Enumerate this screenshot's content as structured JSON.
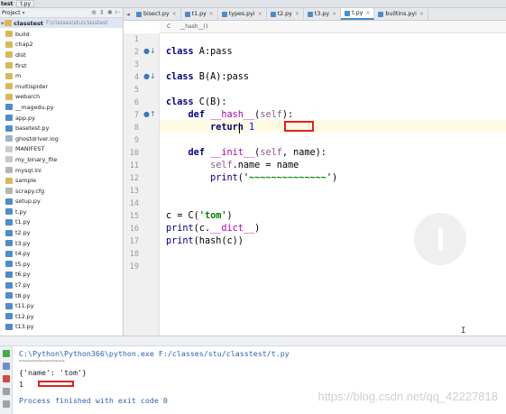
{
  "titlebar": {
    "project_name": "test",
    "file_crumb": "t.py"
  },
  "project_panel": {
    "header_label": "Project",
    "tools": [
      "⊕",
      "⇕",
      "✱",
      "⊢"
    ],
    "root": {
      "name": "classtest",
      "path": "F:\\classes\\stu\\classtest"
    },
    "items": [
      {
        "label": "build",
        "type": "folder"
      },
      {
        "label": "chap2",
        "type": "folder"
      },
      {
        "label": "dist",
        "type": "folder"
      },
      {
        "label": "first",
        "type": "folder"
      },
      {
        "label": "m",
        "type": "folder"
      },
      {
        "label": "multispider",
        "type": "folder"
      },
      {
        "label": "webarch",
        "type": "folder"
      },
      {
        "label": "__magedu.py",
        "type": "py"
      },
      {
        "label": "app.py",
        "type": "py"
      },
      {
        "label": "basetest.py",
        "type": "py"
      },
      {
        "label": "ghostdriver.log",
        "type": "log"
      },
      {
        "label": "MANIFEST",
        "type": "txt"
      },
      {
        "label": "my_binary_file",
        "type": "file"
      },
      {
        "label": "mysql.ini",
        "type": "cfg"
      },
      {
        "label": "sample",
        "type": "sample"
      },
      {
        "label": "scrapy.cfg",
        "type": "cfg"
      },
      {
        "label": "setup.py",
        "type": "py"
      },
      {
        "label": "t.py",
        "type": "py"
      },
      {
        "label": "t1.py",
        "type": "py"
      },
      {
        "label": "t2.py",
        "type": "py"
      },
      {
        "label": "t3.py",
        "type": "py"
      },
      {
        "label": "t4.py",
        "type": "py"
      },
      {
        "label": "t5.py",
        "type": "py"
      },
      {
        "label": "t6.py",
        "type": "py"
      },
      {
        "label": "t7.py",
        "type": "py"
      },
      {
        "label": "t8.py",
        "type": "py"
      },
      {
        "label": "t11.py",
        "type": "py"
      },
      {
        "label": "t12.py",
        "type": "py"
      },
      {
        "label": "t13.py",
        "type": "py"
      }
    ]
  },
  "tabs": [
    {
      "label": "bisect.py",
      "active": false
    },
    {
      "label": "t1.py",
      "active": false
    },
    {
      "label": "types.pyi",
      "active": false
    },
    {
      "label": "t2.py",
      "active": false
    },
    {
      "label": "t3.py",
      "active": false
    },
    {
      "label": "t.py",
      "active": true
    },
    {
      "label": "builtins.pyi",
      "active": false
    }
  ],
  "tab_close_glyph": "×",
  "editor": {
    "breadcrumb": [
      "C",
      "__hash__()"
    ],
    "line_numbers": [
      "1",
      "2",
      "3",
      "4",
      "5",
      "6",
      "7",
      "8",
      "9",
      "10",
      "11",
      "12",
      "13",
      "14",
      "15",
      "16",
      "17",
      "18",
      "19"
    ],
    "gutter_marks": {
      "2": "●↓",
      "4": "●↓",
      "7": "●↑"
    },
    "code": {
      "l2": {
        "kw": "class",
        "rest": " A:pass"
      },
      "l4": {
        "kw": "class",
        "rest": " B(A):pass"
      },
      "l6": {
        "kw": "class",
        "rest": " C(B):"
      },
      "l7": {
        "indent": "    ",
        "kw": "def",
        "sp": " ",
        "name": "__hash__",
        "open": "(",
        "self": "self",
        "close": "):"
      },
      "l8": {
        "indent": "        ",
        "kw": "return",
        "sp": " ",
        "num": "1"
      },
      "l10": {
        "indent": "    ",
        "kw": "def",
        "sp": " ",
        "name": "__init__",
        "open": "(",
        "self": "self",
        "rest": ", name):"
      },
      "l11": {
        "indent": "        ",
        "self": "self",
        "rest": ".name = name"
      },
      "l12": {
        "indent": "        ",
        "fn": "print",
        "open": "(",
        "str": "'~~~~~~~~~~~~~~'",
        "close": ")"
      },
      "l15": {
        "pre": "c = C(",
        "str": "'tom'",
        "close": ")"
      },
      "l16": {
        "fn": "print",
        "pre": "(c.",
        "attr": "__dict__",
        "close": ")"
      },
      "l17": {
        "fn": "print",
        "pre": "(hash(c))"
      }
    }
  },
  "console": {
    "command": "C:\\Python\\Python366\\python.exe F:/classes/stu/classtest/t.py",
    "tilde_line": "~~~~~~~~~~~~~~",
    "dict_output": "{'name': 'tom'}",
    "hash_output": "1",
    "exit_message": "Process finished with exit code 0"
  },
  "watermark": "https://blog.csdn.net/qq_42227818",
  "colors": {
    "keyword": "#000080",
    "dunder": "#b200b2",
    "self": "#94558d",
    "string": "#008000",
    "number": "#0000ff",
    "highlight_box": "#e02020",
    "current_line": "#fffae3"
  }
}
